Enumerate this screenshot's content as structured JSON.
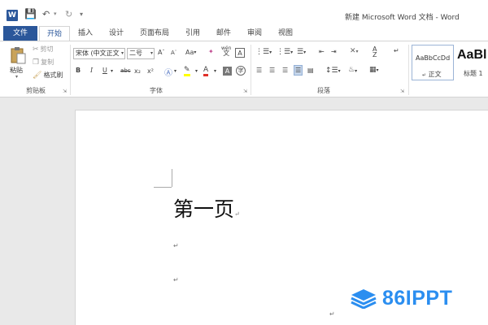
{
  "titlebar": {
    "app_icon_letter": "W",
    "title": "新建 Microsoft Word 文档 - Word",
    "qa_icons": {
      "save": "save-icon",
      "undo": "undo-icon",
      "redo": "redo-icon",
      "customize": "customize-icon"
    }
  },
  "tabs": [
    {
      "label": "文件"
    },
    {
      "label": "开始"
    },
    {
      "label": "插入"
    },
    {
      "label": "设计"
    },
    {
      "label": "页面布局"
    },
    {
      "label": "引用"
    },
    {
      "label": "邮件"
    },
    {
      "label": "审阅"
    },
    {
      "label": "视图"
    }
  ],
  "ribbon": {
    "clipboard": {
      "paste": "粘贴",
      "cut": "剪切",
      "copy": "复制",
      "format_painter": "格式刷",
      "group": "剪贴板"
    },
    "font": {
      "font_name": "宋体 (中文正文",
      "font_size": "二号",
      "grow": "A",
      "shrink": "A",
      "change_case": "Aa",
      "phonetic": "wén",
      "bold": "B",
      "italic": "I",
      "underline": "U",
      "strike": "abc",
      "subscript": "x₂",
      "superscript": "x²",
      "font_color_letter": "A",
      "group": "字体"
    },
    "paragraph": {
      "group": "段落"
    },
    "styles": {
      "normal_sample": "AaBbCcDd",
      "normal_name": "正文",
      "heading_sample": "AaBl",
      "heading_name": "标题 1"
    }
  },
  "document": {
    "heading": "第一页"
  },
  "watermark": {
    "text": "86IPPT",
    "color": "#2b8ef0"
  },
  "colors": {
    "accent": "#2b579a"
  }
}
